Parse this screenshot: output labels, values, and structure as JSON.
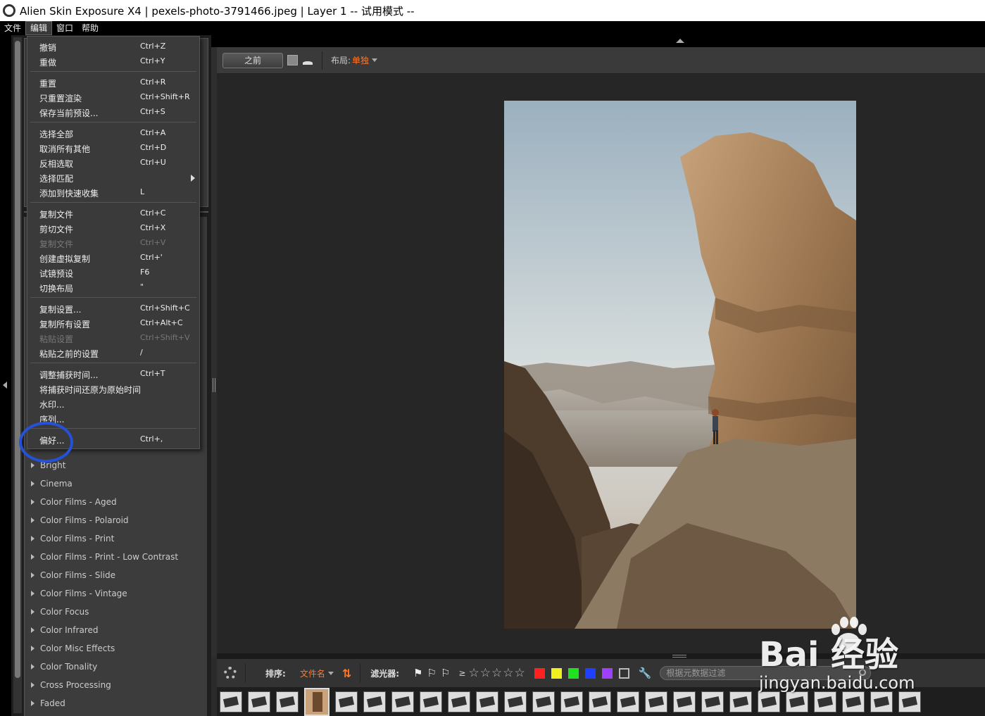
{
  "window": {
    "title": "Alien Skin Exposure X4 | pexels-photo-3791466.jpeg | Layer 1 -- 试用模式 --"
  },
  "menubar": {
    "items": [
      {
        "label": "文件"
      },
      {
        "label": "编辑"
      },
      {
        "label": "窗口"
      },
      {
        "label": "帮助"
      }
    ]
  },
  "edit_menu": {
    "items": [
      {
        "label": "撤销",
        "shortcut": "Ctrl+Z",
        "enabled": true
      },
      {
        "label": "重做",
        "shortcut": "Ctrl+Y",
        "enabled": true
      },
      {
        "label": "重置",
        "shortcut": "Ctrl+R",
        "enabled": true
      },
      {
        "label": "只重置渲染",
        "shortcut": "Ctrl+Shift+R",
        "enabled": true
      },
      {
        "label": "保存当前预设...",
        "shortcut": "Ctrl+S",
        "enabled": true
      },
      {
        "label": "选择全部",
        "shortcut": "Ctrl+A",
        "enabled": true
      },
      {
        "label": "取消所有其他",
        "shortcut": "Ctrl+D",
        "enabled": true
      },
      {
        "label": "反相选取",
        "shortcut": "Ctrl+U",
        "enabled": true
      },
      {
        "label": "选择匹配",
        "shortcut": "",
        "enabled": true
      },
      {
        "label": "添加到快速收集",
        "shortcut": "L",
        "enabled": true
      },
      {
        "label": "复制文件",
        "shortcut": "Ctrl+C",
        "enabled": true
      },
      {
        "label": "剪切文件",
        "shortcut": "Ctrl+X",
        "enabled": true
      },
      {
        "label": "复制文件",
        "shortcut": "Ctrl+V",
        "enabled": false
      },
      {
        "label": "创建虚拟复制",
        "shortcut": "Ctrl+'",
        "enabled": true
      },
      {
        "label": "试镜预设",
        "shortcut": "F6",
        "enabled": true
      },
      {
        "label": "切换布局",
        "shortcut": "\"",
        "enabled": true
      },
      {
        "label": "复制设置...",
        "shortcut": "Ctrl+Shift+C",
        "enabled": true
      },
      {
        "label": "复制所有设置",
        "shortcut": "Ctrl+Alt+C",
        "enabled": true
      },
      {
        "label": "粘贴设置",
        "shortcut": "Ctrl+Shift+V",
        "enabled": false
      },
      {
        "label": "粘贴之前的设置",
        "shortcut": "/",
        "enabled": true
      },
      {
        "label": "调整捕获时间...",
        "shortcut": "Ctrl+T",
        "enabled": true
      },
      {
        "label": "将捕获时间还原为原始时间",
        "shortcut": "",
        "enabled": true
      },
      {
        "label": "水印...",
        "shortcut": "",
        "enabled": true
      },
      {
        "label": "序列...",
        "shortcut": "",
        "enabled": true
      },
      {
        "label": "偏好...",
        "shortcut": "Ctrl+,",
        "enabled": true
      }
    ]
  },
  "presets": {
    "items": [
      {
        "label": "Bright"
      },
      {
        "label": "Cinema"
      },
      {
        "label": "Color Films - Aged"
      },
      {
        "label": "Color Films - Polaroid"
      },
      {
        "label": "Color Films - Print"
      },
      {
        "label": "Color Films - Print - Low Contrast"
      },
      {
        "label": "Color Films - Slide"
      },
      {
        "label": "Color Films - Vintage"
      },
      {
        "label": "Color Focus"
      },
      {
        "label": "Color Infrared"
      },
      {
        "label": "Color Misc Effects"
      },
      {
        "label": "Color Tonality"
      },
      {
        "label": "Cross Processing"
      },
      {
        "label": "Faded"
      }
    ]
  },
  "toolbar": {
    "before_label": "之前",
    "layout_label": "布局:",
    "layout_value": "单独"
  },
  "filmbar": {
    "sort_label": "排序:",
    "sort_value": "文件名",
    "filter_label": "滤光器:",
    "rating_prefix": "≥",
    "search_placeholder": "根据元数据过滤",
    "color_labels": [
      "#ff2020",
      "#f0f020",
      "#20e020",
      "#2040ff",
      "#a040ff"
    ]
  },
  "watermark": {
    "logo_text": "Bai  经验",
    "url": "jingyan.baidu.com"
  },
  "colors": {
    "accent": "#ff7a2a",
    "highlight_circle": "#2451d6"
  }
}
